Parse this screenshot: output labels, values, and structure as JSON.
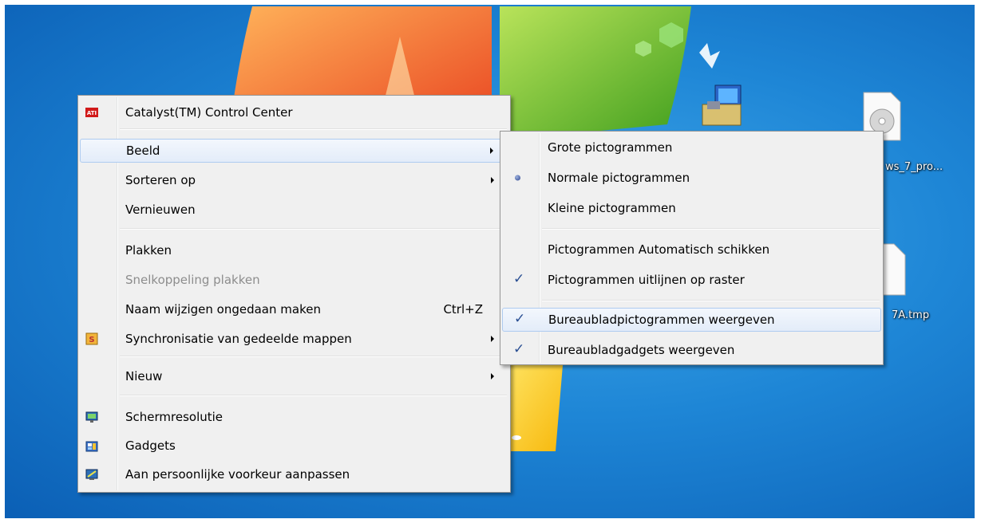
{
  "desktop": {
    "icons": [
      {
        "name": "setup-program-icon",
        "label": ""
      },
      {
        "name": "windows7-iso-file-icon",
        "label": "ws_7_pro..."
      },
      {
        "name": "tmp-file-icon",
        "label": "7A.tmp"
      }
    ]
  },
  "context_menu": {
    "items": [
      {
        "label": "Catalyst(TM) Control Center",
        "icon": "ati-icon"
      },
      {
        "label": "Beeld",
        "submenu": true,
        "highlighted": true
      },
      {
        "label": "Sorteren op",
        "submenu": true
      },
      {
        "label": "Vernieuwen"
      },
      {
        "label": "Plakken"
      },
      {
        "label": "Snelkoppeling plakken",
        "disabled": true
      },
      {
        "label": "Naam wijzigen ongedaan maken",
        "shortcut": "Ctrl+Z"
      },
      {
        "label": "Synchronisatie van gedeelde mappen",
        "icon": "sync-shared-folders-icon",
        "submenu": true
      },
      {
        "label": "Nieuw",
        "submenu": true
      },
      {
        "label": "Schermresolutie",
        "icon": "screen-resolution-icon"
      },
      {
        "label": "Gadgets",
        "icon": "gadgets-icon"
      },
      {
        "label": "Aan persoonlijke voorkeur aanpassen",
        "icon": "personalize-icon"
      }
    ]
  },
  "view_submenu": {
    "items": [
      {
        "label": "Grote pictogrammen"
      },
      {
        "label": "Normale pictogrammen",
        "state": "radio-selected"
      },
      {
        "label": "Kleine pictogrammen"
      },
      {
        "label": "Pictogrammen Automatisch schikken"
      },
      {
        "label": "Pictogrammen uitlijnen op raster",
        "state": "checked"
      },
      {
        "label": "Bureaubladpictogrammen weergeven",
        "state": "checked",
        "highlighted": true
      },
      {
        "label": "Bureaubladgadgets weergeven",
        "state": "checked"
      }
    ]
  },
  "colors": {
    "desktop_blue": "#1e86d6",
    "menu_bg": "#f0f0f0",
    "highlight_border": "#aecbf0"
  }
}
